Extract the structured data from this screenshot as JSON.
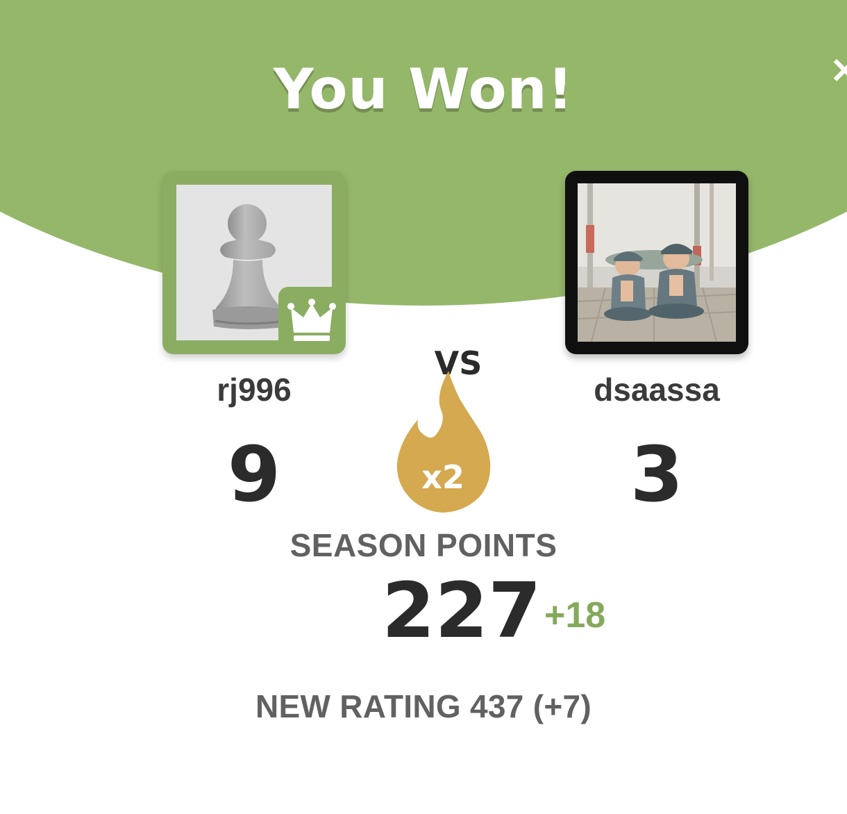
{
  "header": {
    "title": "You Won!",
    "close_icon": "close-icon"
  },
  "players": {
    "left": {
      "name": "rj996",
      "score": "9",
      "avatar_icon": "pawn-icon",
      "badge_icon": "crown-icon"
    },
    "right": {
      "name": "dsaassa",
      "score": "3",
      "avatar_icon": "photo-avatar"
    }
  },
  "versus": {
    "label": "VS",
    "multiplier": "x2",
    "multiplier_icon": "flame-icon"
  },
  "season": {
    "label": "SEASON POINTS",
    "points": "227",
    "delta": "+18"
  },
  "rating": {
    "text": "NEW RATING 437 (+7)"
  },
  "colors": {
    "header_green": "#95b76a",
    "winner_frame": "#8bad62",
    "flame_gold": "#d4a94f",
    "delta_green": "#85a95b",
    "text_dark": "#2b2b2b",
    "text_grey": "#616161"
  }
}
